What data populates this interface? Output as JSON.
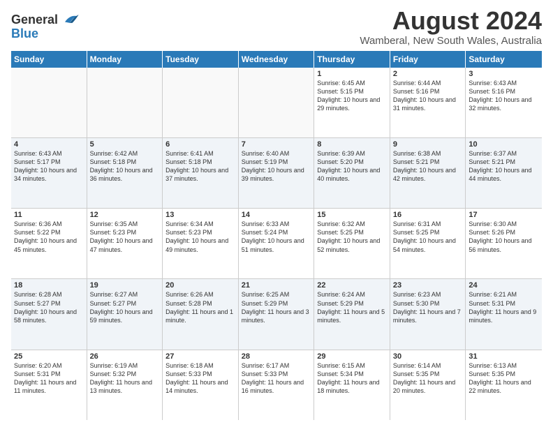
{
  "logo": {
    "line1": "General",
    "line2": "Blue"
  },
  "title": "August 2024",
  "subtitle": "Wamberal, New South Wales, Australia",
  "header_days": [
    "Sunday",
    "Monday",
    "Tuesday",
    "Wednesday",
    "Thursday",
    "Friday",
    "Saturday"
  ],
  "weeks": [
    [
      {
        "day": "",
        "info": "",
        "empty": true
      },
      {
        "day": "",
        "info": "",
        "empty": true
      },
      {
        "day": "",
        "info": "",
        "empty": true
      },
      {
        "day": "",
        "info": "",
        "empty": true
      },
      {
        "day": "1",
        "info": "Sunrise: 6:45 AM\nSunset: 5:15 PM\nDaylight: 10 hours\nand 29 minutes."
      },
      {
        "day": "2",
        "info": "Sunrise: 6:44 AM\nSunset: 5:16 PM\nDaylight: 10 hours\nand 31 minutes."
      },
      {
        "day": "3",
        "info": "Sunrise: 6:43 AM\nSunset: 5:16 PM\nDaylight: 10 hours\nand 32 minutes."
      }
    ],
    [
      {
        "day": "4",
        "info": "Sunrise: 6:43 AM\nSunset: 5:17 PM\nDaylight: 10 hours\nand 34 minutes."
      },
      {
        "day": "5",
        "info": "Sunrise: 6:42 AM\nSunset: 5:18 PM\nDaylight: 10 hours\nand 36 minutes."
      },
      {
        "day": "6",
        "info": "Sunrise: 6:41 AM\nSunset: 5:18 PM\nDaylight: 10 hours\nand 37 minutes."
      },
      {
        "day": "7",
        "info": "Sunrise: 6:40 AM\nSunset: 5:19 PM\nDaylight: 10 hours\nand 39 minutes."
      },
      {
        "day": "8",
        "info": "Sunrise: 6:39 AM\nSunset: 5:20 PM\nDaylight: 10 hours\nand 40 minutes."
      },
      {
        "day": "9",
        "info": "Sunrise: 6:38 AM\nSunset: 5:21 PM\nDaylight: 10 hours\nand 42 minutes."
      },
      {
        "day": "10",
        "info": "Sunrise: 6:37 AM\nSunset: 5:21 PM\nDaylight: 10 hours\nand 44 minutes."
      }
    ],
    [
      {
        "day": "11",
        "info": "Sunrise: 6:36 AM\nSunset: 5:22 PM\nDaylight: 10 hours\nand 45 minutes."
      },
      {
        "day": "12",
        "info": "Sunrise: 6:35 AM\nSunset: 5:23 PM\nDaylight: 10 hours\nand 47 minutes."
      },
      {
        "day": "13",
        "info": "Sunrise: 6:34 AM\nSunset: 5:23 PM\nDaylight: 10 hours\nand 49 minutes."
      },
      {
        "day": "14",
        "info": "Sunrise: 6:33 AM\nSunset: 5:24 PM\nDaylight: 10 hours\nand 51 minutes."
      },
      {
        "day": "15",
        "info": "Sunrise: 6:32 AM\nSunset: 5:25 PM\nDaylight: 10 hours\nand 52 minutes."
      },
      {
        "day": "16",
        "info": "Sunrise: 6:31 AM\nSunset: 5:25 PM\nDaylight: 10 hours\nand 54 minutes."
      },
      {
        "day": "17",
        "info": "Sunrise: 6:30 AM\nSunset: 5:26 PM\nDaylight: 10 hours\nand 56 minutes."
      }
    ],
    [
      {
        "day": "18",
        "info": "Sunrise: 6:28 AM\nSunset: 5:27 PM\nDaylight: 10 hours\nand 58 minutes."
      },
      {
        "day": "19",
        "info": "Sunrise: 6:27 AM\nSunset: 5:27 PM\nDaylight: 10 hours\nand 59 minutes."
      },
      {
        "day": "20",
        "info": "Sunrise: 6:26 AM\nSunset: 5:28 PM\nDaylight: 11 hours\nand 1 minute."
      },
      {
        "day": "21",
        "info": "Sunrise: 6:25 AM\nSunset: 5:29 PM\nDaylight: 11 hours\nand 3 minutes."
      },
      {
        "day": "22",
        "info": "Sunrise: 6:24 AM\nSunset: 5:29 PM\nDaylight: 11 hours\nand 5 minutes."
      },
      {
        "day": "23",
        "info": "Sunrise: 6:23 AM\nSunset: 5:30 PM\nDaylight: 11 hours\nand 7 minutes."
      },
      {
        "day": "24",
        "info": "Sunrise: 6:21 AM\nSunset: 5:31 PM\nDaylight: 11 hours\nand 9 minutes."
      }
    ],
    [
      {
        "day": "25",
        "info": "Sunrise: 6:20 AM\nSunset: 5:31 PM\nDaylight: 11 hours\nand 11 minutes."
      },
      {
        "day": "26",
        "info": "Sunrise: 6:19 AM\nSunset: 5:32 PM\nDaylight: 11 hours\nand 13 minutes."
      },
      {
        "day": "27",
        "info": "Sunrise: 6:18 AM\nSunset: 5:33 PM\nDaylight: 11 hours\nand 14 minutes."
      },
      {
        "day": "28",
        "info": "Sunrise: 6:17 AM\nSunset: 5:33 PM\nDaylight: 11 hours\nand 16 minutes."
      },
      {
        "day": "29",
        "info": "Sunrise: 6:15 AM\nSunset: 5:34 PM\nDaylight: 11 hours\nand 18 minutes."
      },
      {
        "day": "30",
        "info": "Sunrise: 6:14 AM\nSunset: 5:35 PM\nDaylight: 11 hours\nand 20 minutes."
      },
      {
        "day": "31",
        "info": "Sunrise: 6:13 AM\nSunset: 5:35 PM\nDaylight: 11 hours\nand 22 minutes."
      }
    ]
  ]
}
